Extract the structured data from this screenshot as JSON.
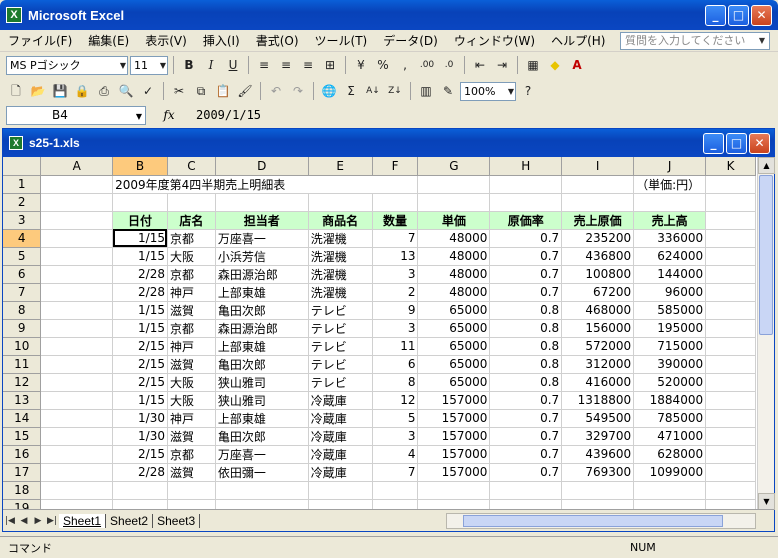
{
  "app": {
    "title": "Microsoft Excel",
    "help_placeholder": "質問を入力してください"
  },
  "menu": [
    "ファイル(F)",
    "編集(E)",
    "表示(V)",
    "挿入(I)",
    "書式(O)",
    "ツール(T)",
    "データ(D)",
    "ウィンドウ(W)",
    "ヘルプ(H)"
  ],
  "toolbar": {
    "font_name": "MS Pゴシック",
    "font_size": "11",
    "zoom": "100%",
    "bold": "B",
    "italic": "I",
    "underline": "U",
    "percent": "%",
    "comma": ",",
    "autosum": "Σ"
  },
  "formula": {
    "name_box": "B4",
    "fx": "fx",
    "value": "2009/1/15"
  },
  "workbook": {
    "title": "s25-1.xls"
  },
  "columns": [
    "A",
    "B",
    "C",
    "D",
    "E",
    "F",
    "G",
    "H",
    "I",
    "J",
    "K"
  ],
  "sheet": {
    "title": "2009年度第4四半期売上明細表",
    "unit": "（単価:円）",
    "headers": [
      "日付",
      "店名",
      "担当者",
      "商品名",
      "数量",
      "単価",
      "原価率",
      "売上原価",
      "売上高"
    ],
    "rows": [
      [
        "1/15",
        "京都",
        "万座喜一",
        "洗濯機",
        "7",
        "48000",
        "0.7",
        "235200",
        "336000"
      ],
      [
        "1/15",
        "大阪",
        "小浜芳信",
        "洗濯機",
        "13",
        "48000",
        "0.7",
        "436800",
        "624000"
      ],
      [
        "2/28",
        "京都",
        "森田源治郎",
        "洗濯機",
        "3",
        "48000",
        "0.7",
        "100800",
        "144000"
      ],
      [
        "2/28",
        "神戸",
        "上部東雄",
        "洗濯機",
        "2",
        "48000",
        "0.7",
        "67200",
        "96000"
      ],
      [
        "1/15",
        "滋賀",
        "亀田次郎",
        "テレビ",
        "9",
        "65000",
        "0.8",
        "468000",
        "585000"
      ],
      [
        "1/15",
        "京都",
        "森田源治郎",
        "テレビ",
        "3",
        "65000",
        "0.8",
        "156000",
        "195000"
      ],
      [
        "2/15",
        "神戸",
        "上部東雄",
        "テレビ",
        "11",
        "65000",
        "0.8",
        "572000",
        "715000"
      ],
      [
        "2/15",
        "滋賀",
        "亀田次郎",
        "テレビ",
        "6",
        "65000",
        "0.8",
        "312000",
        "390000"
      ],
      [
        "2/15",
        "大阪",
        "狭山雅司",
        "テレビ",
        "8",
        "65000",
        "0.8",
        "416000",
        "520000"
      ],
      [
        "1/15",
        "大阪",
        "狭山雅司",
        "冷蔵庫",
        "12",
        "157000",
        "0.7",
        "1318800",
        "1884000"
      ],
      [
        "1/30",
        "神戸",
        "上部東雄",
        "冷蔵庫",
        "5",
        "157000",
        "0.7",
        "549500",
        "785000"
      ],
      [
        "1/30",
        "滋賀",
        "亀田次郎",
        "冷蔵庫",
        "3",
        "157000",
        "0.7",
        "329700",
        "471000"
      ],
      [
        "2/15",
        "京都",
        "万座喜一",
        "冷蔵庫",
        "4",
        "157000",
        "0.7",
        "439600",
        "628000"
      ],
      [
        "2/28",
        "滋賀",
        "依田彌一",
        "冷蔵庫",
        "7",
        "157000",
        "0.7",
        "769300",
        "1099000"
      ]
    ]
  },
  "tabs": [
    "Sheet1",
    "Sheet2",
    "Sheet3"
  ],
  "status": {
    "mode": "コマンド",
    "num": "NUM"
  }
}
